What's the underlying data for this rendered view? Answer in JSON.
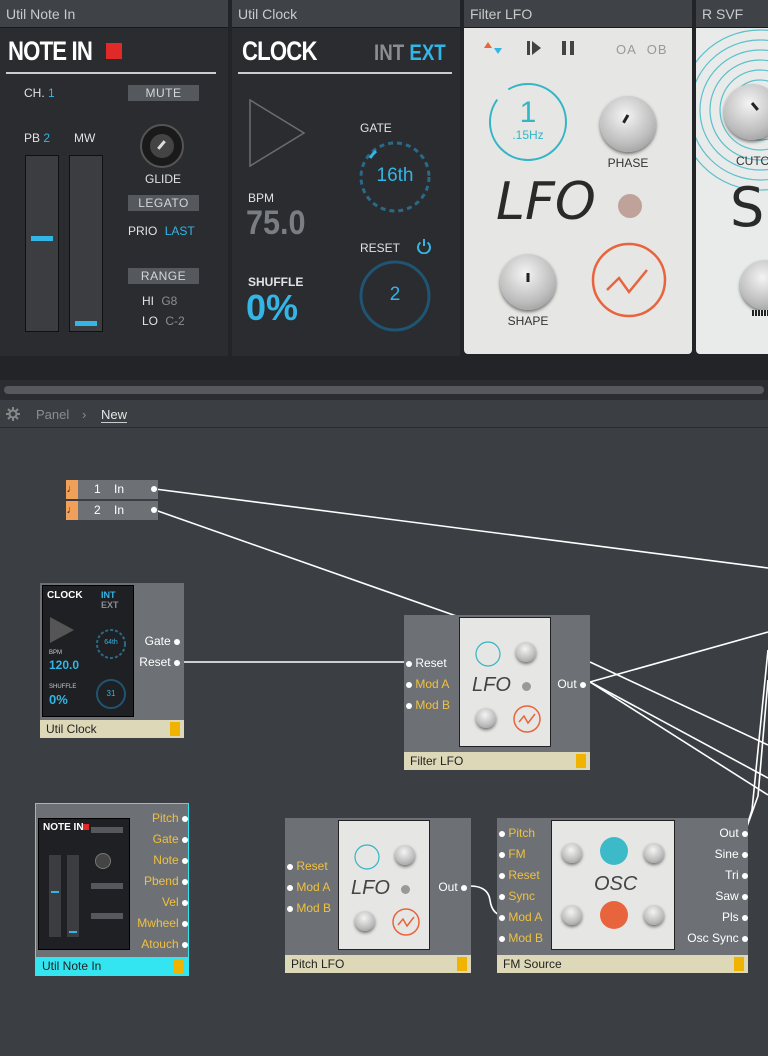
{
  "top_panels": {
    "note_in": {
      "bar": "Util Note In",
      "title": "NOTE IN",
      "ch_label": "CH.",
      "ch_value": "1",
      "mute": "MUTE",
      "pb_label": "PB",
      "pb_value": "2",
      "mw_label": "MW",
      "glide": "GLIDE",
      "legato": "LEGATO",
      "prio_label": "PRIO",
      "prio_value": "LAST",
      "range": "RANGE",
      "hi_label": "HI",
      "hi_value": "G8",
      "lo_label": "LO",
      "lo_value": "C-2"
    },
    "clock": {
      "bar": "Util Clock",
      "title": "CLOCK",
      "int": "INT",
      "ext": "EXT",
      "gate_label": "GATE",
      "gate_value": "16th",
      "bpm_label": "BPM",
      "bpm_value": "75.0",
      "reset_label": "RESET",
      "reset_value": "2",
      "shuffle_label": "SHUFFLE",
      "shuffle_value": "0%"
    },
    "filter_lfo": {
      "bar": "Filter LFO",
      "rate_value": "1",
      "rate_unit": ".15Hz",
      "phase": "PHASE",
      "lfo": "LFO",
      "shape": "SHAPE",
      "oa": "OA",
      "ob": "OB"
    },
    "rsvf": {
      "bar": "R SVF",
      "cutoff": "CUTO",
      "big": "S"
    }
  },
  "breadcrumb": {
    "root": "Panel",
    "sep": "›",
    "current": "New"
  },
  "inputs": [
    {
      "num": "1",
      "label": "In"
    },
    {
      "num": "2",
      "label": "In"
    }
  ],
  "modules": {
    "util_clock": {
      "label": "Util Clock",
      "ports_out": [
        "Gate",
        "Reset"
      ],
      "thumb": {
        "title": "CLOCK",
        "int": "INT",
        "ext": "EXT",
        "gate": "64th",
        "bpm_label": "BPM",
        "bpm": "120.0",
        "shuffle_label": "SHUFFLE",
        "shuffle": "0%",
        "reset": "31"
      }
    },
    "filter_lfo": {
      "label": "Filter LFO",
      "ports_in": [
        "Reset",
        "Mod A",
        "Mod B"
      ],
      "port_out": "Out",
      "thumb_text": "LFO"
    },
    "util_note_in": {
      "label": "Util Note In",
      "ports_out": [
        "Pitch",
        "Gate",
        "Note",
        "Pbend",
        "Vel",
        "Mwheel",
        "Atouch"
      ],
      "thumb_title": "NOTE IN"
    },
    "pitch_lfo": {
      "label": "Pitch LFO",
      "ports_in": [
        "Reset",
        "Mod A",
        "Mod B"
      ],
      "port_out": "Out",
      "thumb_text": "LFO"
    },
    "fm_source": {
      "label": "FM Source",
      "ports_in": [
        "Pitch",
        "FM",
        "Reset",
        "Sync",
        "Mod A",
        "Mod B"
      ],
      "ports_out": [
        "Out",
        "Sine",
        "Tri",
        "Saw",
        "Pls",
        "Osc Sync"
      ],
      "thumb_text": "OSC"
    }
  },
  "colors": {
    "accent": "#33b5e5",
    "selected": "#33e5f0",
    "port_yellow": "#f0c040",
    "label_bg": "#ddd9b8",
    "lfo_orange": "#e8643c"
  }
}
